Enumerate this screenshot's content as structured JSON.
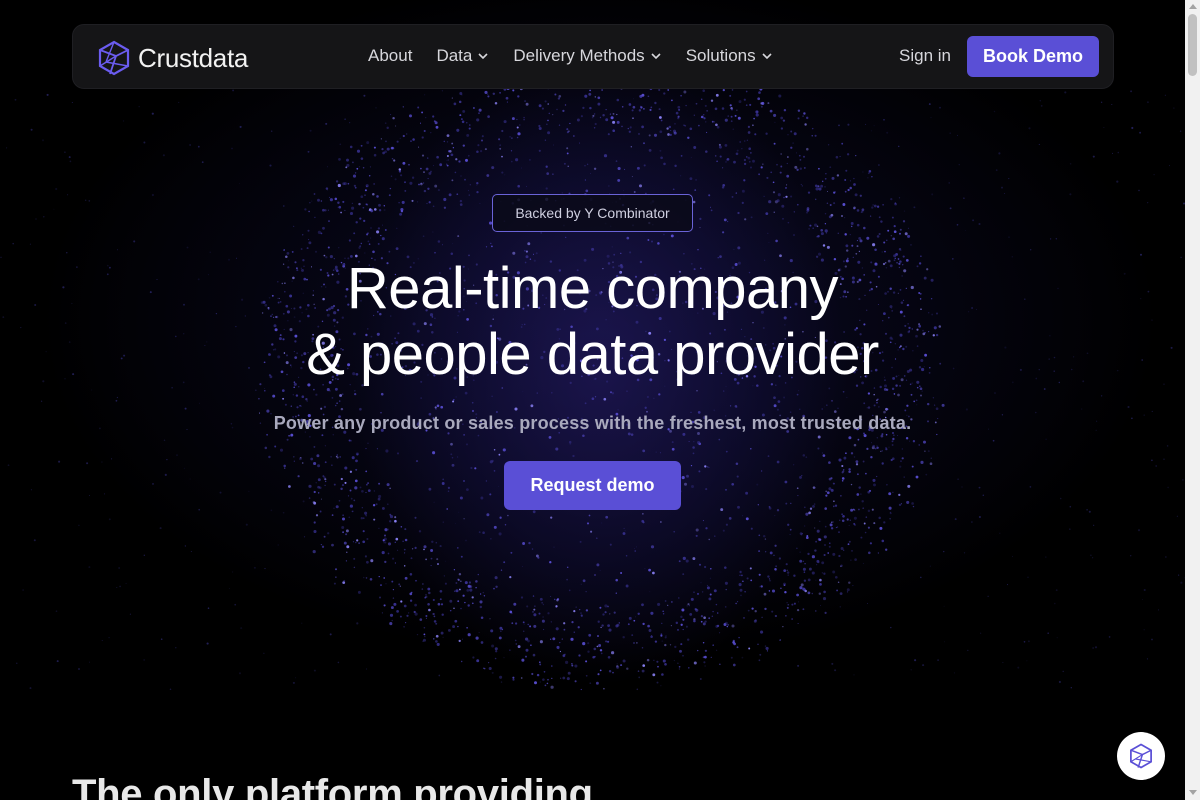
{
  "brand": {
    "name": "Crustdata",
    "logo_icon": "crustdata-logo-icon"
  },
  "nav": {
    "links": [
      {
        "label": "About",
        "has_dropdown": false
      },
      {
        "label": "Data",
        "has_dropdown": true
      },
      {
        "label": "Delivery Methods",
        "has_dropdown": true
      },
      {
        "label": "Solutions",
        "has_dropdown": true
      }
    ],
    "sign_in": "Sign in",
    "book_demo": "Book Demo"
  },
  "hero": {
    "badge": "Backed by Y Combinator",
    "headline_line1": "Real-time company",
    "headline_line2": "& people data provider",
    "subheadline": "Power any product or sales process with the freshest, most trusted data.",
    "cta": "Request demo"
  },
  "next_section": {
    "title": "The only platform providing"
  },
  "colors": {
    "accent": "#5a4fd6",
    "background": "#000000",
    "navbar": "#151517",
    "badge_border": "#6a63d8"
  }
}
